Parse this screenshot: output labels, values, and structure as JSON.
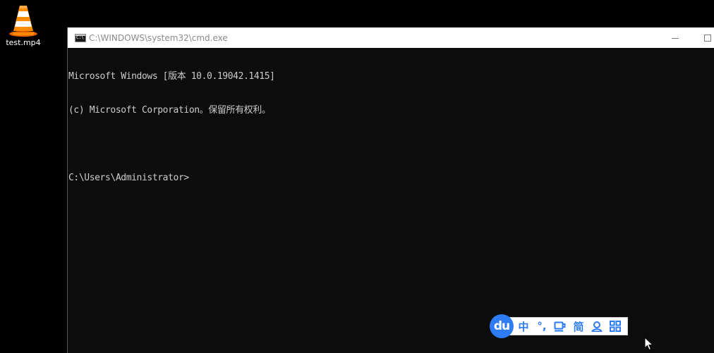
{
  "desktop": {
    "icons": [
      {
        "label": "test.mp4",
        "icon": "vlc-cone-icon"
      }
    ]
  },
  "window": {
    "title": "C:\\WINDOWS\\system32\\cmd.exe",
    "icon": "cmd-icon",
    "controls": {
      "minimize": "minimize-icon",
      "maximize": "maximize-icon"
    }
  },
  "console": {
    "lines": [
      "Microsoft Windows [版本 10.0.19042.1415]",
      "(c) Microsoft Corporation。保留所有权利。",
      "",
      "C:\\Users\\Administrator>"
    ]
  },
  "ime": {
    "logo": "du",
    "items": [
      {
        "label": "中",
        "name": "ime-mode-chinese"
      },
      {
        "label": "°,",
        "name": "ime-punctuation"
      },
      {
        "label": "",
        "name": "ime-cup-icon"
      },
      {
        "label": "简",
        "name": "ime-simplified"
      },
      {
        "label": "",
        "name": "ime-user-icon"
      },
      {
        "label": "",
        "name": "ime-grid-icon"
      }
    ]
  },
  "colors": {
    "desktop_bg": "#000000",
    "console_bg": "#0c0c0c",
    "console_text": "#cccccc",
    "ime_accent": "#2d7cf6"
  }
}
